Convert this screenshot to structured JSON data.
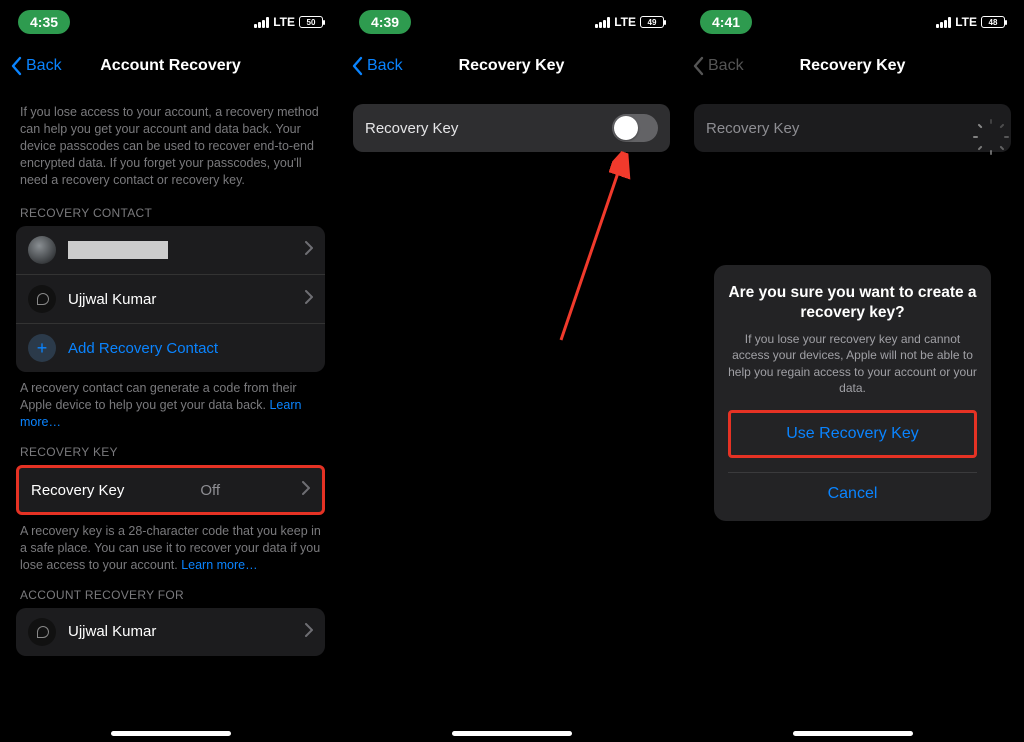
{
  "screen1": {
    "time": "4:35",
    "carrier": "LTE",
    "battery": "50",
    "back": "Back",
    "title": "Account Recovery",
    "intro": "If you lose access to your account, a recovery method can help you get your account and data back. Your device passcodes can be used to recover end-to-end encrypted data. If you forget your passcodes, you'll need a recovery contact or recovery key.",
    "sec_contact": "RECOVERY CONTACT",
    "contact2": "Ujjwal Kumar",
    "add_contact": "Add Recovery Contact",
    "contact_foot1": "A recovery contact can generate a code from their Apple device to help you get your data back. ",
    "learn": "Learn more…",
    "sec_key": "RECOVERY KEY",
    "key_label": "Recovery Key",
    "key_value": "Off",
    "key_foot": "A recovery key is a 28-character code that you keep in a safe place. You can use it to recover your data if you lose access to your account. ",
    "sec_for": "ACCOUNT RECOVERY FOR",
    "for_name": "Ujjwal Kumar"
  },
  "screen2": {
    "time": "4:39",
    "carrier": "LTE",
    "battery": "49",
    "back": "Back",
    "title": "Recovery Key",
    "row_label": "Recovery Key"
  },
  "screen3": {
    "time": "4:41",
    "carrier": "LTE",
    "battery": "48",
    "back": "Back",
    "title": "Recovery Key",
    "row_label": "Recovery Key",
    "alert_title": "Are you sure you want to create a recovery key?",
    "alert_msg": "If you lose your recovery key and cannot access your devices, Apple will not be able to help you regain access to your account or your data.",
    "alert_primary": "Use Recovery Key",
    "alert_cancel": "Cancel"
  }
}
